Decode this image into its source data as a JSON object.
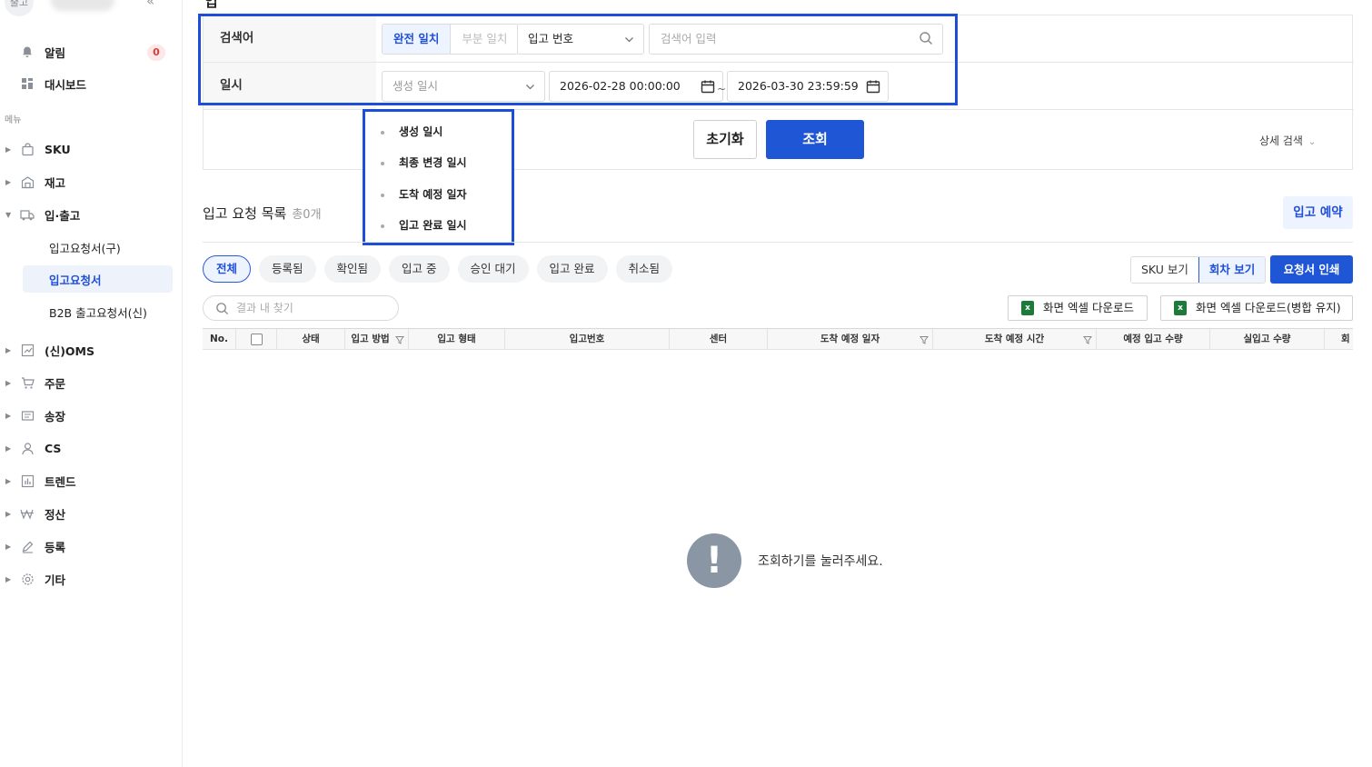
{
  "sidebar": {
    "avatar_text": "출고",
    "collapse": "«",
    "alarm": {
      "label": "알림",
      "count": "0"
    },
    "dashboard": "대시보드",
    "section": "메뉴",
    "items": [
      "SKU",
      "재고",
      "입·출고"
    ],
    "sub_items": [
      "입고요청서(구)",
      "입고요청서",
      "B2B 출고요청서(신)"
    ],
    "more_items": [
      "(신)OMS",
      "주문",
      "송장",
      "CS",
      "트렌드",
      "정산",
      "등록",
      "기타"
    ]
  },
  "page": {
    "title_fragment": "입"
  },
  "filters": {
    "keyword_label": "검색어",
    "match_exact": "완전 일치",
    "match_partial": "부분 일치",
    "keyword_field": "입고 번호",
    "keyword_placeholder": "검색어 입력",
    "date_label": "일시",
    "date_type": "생성 일시",
    "date_from": "2026-02-28 00:00:00",
    "date_sep": "~",
    "date_to": "2026-03-30 23:59:59",
    "reset": "초기화",
    "search": "조회",
    "advanced": "상세 검색",
    "chev": "⌄"
  },
  "date_type_options": [
    "생성 일시",
    "최종 변경 일시",
    "도착 예정 일자",
    "입고 완료 일시"
  ],
  "list": {
    "title": "입고 요청 목록",
    "count": "총0개",
    "reserve_button": "입고 예약",
    "status_chips": [
      "전체",
      "등록됨",
      "확인됨",
      "입고 중",
      "승인 대기",
      "입고 완료",
      "취소됨"
    ],
    "view_sku": "SKU 보기",
    "view_round": "회차 보기",
    "print": "요청서 인쇄",
    "result_search_placeholder": "결과 내 찾기",
    "excel_download": "화면 엑셀 다운로드",
    "excel_download_merged": "화면 엑셀 다운로드(병합 유지)",
    "columns": [
      "No.",
      "상태",
      "입고 방법",
      "입고 형태",
      "입고번호",
      "센터",
      "도착 예정 일자",
      "도착 예정 시간",
      "예정 입고 수량",
      "실입고 수량",
      "회"
    ],
    "empty_message": "조회하기를 눌러주세요."
  }
}
